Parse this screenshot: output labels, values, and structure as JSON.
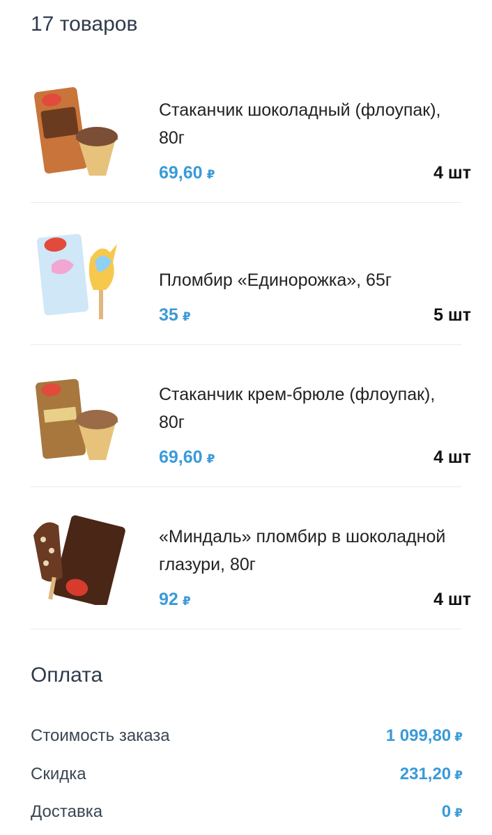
{
  "header": {
    "count_title": "17 товаров"
  },
  "currency_symbol": "₽",
  "items": [
    {
      "name_line1": "Стаканчик шоколадный (флоупак),",
      "name_line2": "80г",
      "price": "69,60",
      "qty": "4 шт",
      "icon": "chocolate-cone-icecream-image"
    },
    {
      "name_line1": "Пломбир «Единорожка», 65г",
      "name_line2": "",
      "price": "35",
      "qty": "5 шт",
      "icon": "unicorn-popsicle-image"
    },
    {
      "name_line1": "Стаканчик крем-брюле (флоупак),",
      "name_line2": "80г",
      "price": "69,60",
      "qty": "4 шт",
      "icon": "creme-brulee-cone-image"
    },
    {
      "name_line1": "«Миндаль» пломбир в шоколадной",
      "name_line2": "глазури, 80г",
      "price": "92",
      "qty": "4 шт",
      "icon": "almond-eskimo-image"
    }
  ],
  "payment": {
    "title": "Оплата",
    "rows": [
      {
        "label": "Стоимость заказа",
        "value": "1 099,80"
      },
      {
        "label": "Скидка",
        "value": "231,20"
      },
      {
        "label": "Доставка",
        "value": "0"
      }
    ]
  }
}
